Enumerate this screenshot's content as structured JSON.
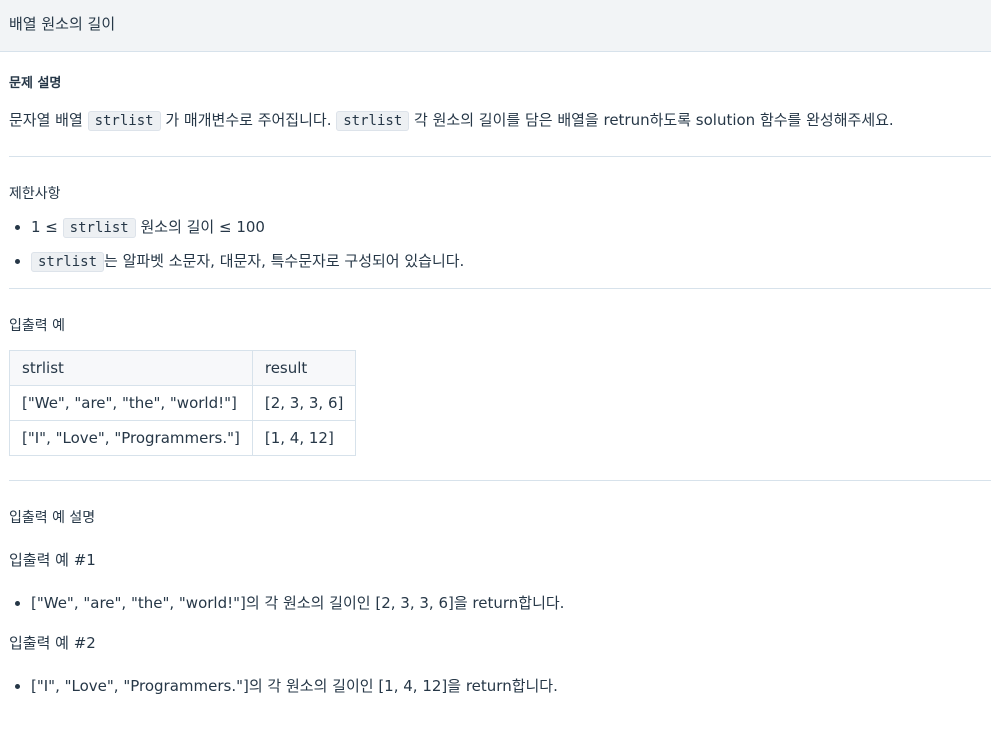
{
  "title": "배열 원소의 길이",
  "description": {
    "heading": "문제 설명",
    "text_1": "문자열 배열",
    "code_1": "strlist",
    "text_2": "가 매개변수로 주어집니다.",
    "code_2": "strlist",
    "text_3": "각 원소의 길이를 담은 배열을 retrun하도록 solution 함수를 완성해주세요."
  },
  "constraints": {
    "heading": "제한사항",
    "item1_prefix": "1 ≤",
    "item1_code": "strlist",
    "item1_suffix": "원소의 길이 ≤ 100",
    "item2_code": "strlist",
    "item2_suffix": "는 알파벳 소문자, 대문자, 특수문자로 구성되어 있습니다."
  },
  "examples": {
    "heading": "입출력 예",
    "columns": [
      "strlist",
      "result"
    ],
    "rows": [
      [
        "[\"We\", \"are\", \"the\", \"world!\"]",
        "[2, 3, 3, 6]"
      ],
      [
        "[\"I\", \"Love\", \"Programmers.\"]",
        "[1, 4, 12]"
      ]
    ]
  },
  "explanations": {
    "heading": "입출력 예 설명",
    "ex1_title": "입출력 예 #1",
    "ex1_item": "[\"We\", \"are\", \"the\", \"world!\"]의 각 원소의 길이인 [2, 3, 3, 6]을 return합니다.",
    "ex2_title": "입출력 예 #2",
    "ex2_item": "[\"I\", \"Love\", \"Programmers.\"]의 각 원소의 길이인 [1, 4, 12]을 return합니다."
  }
}
